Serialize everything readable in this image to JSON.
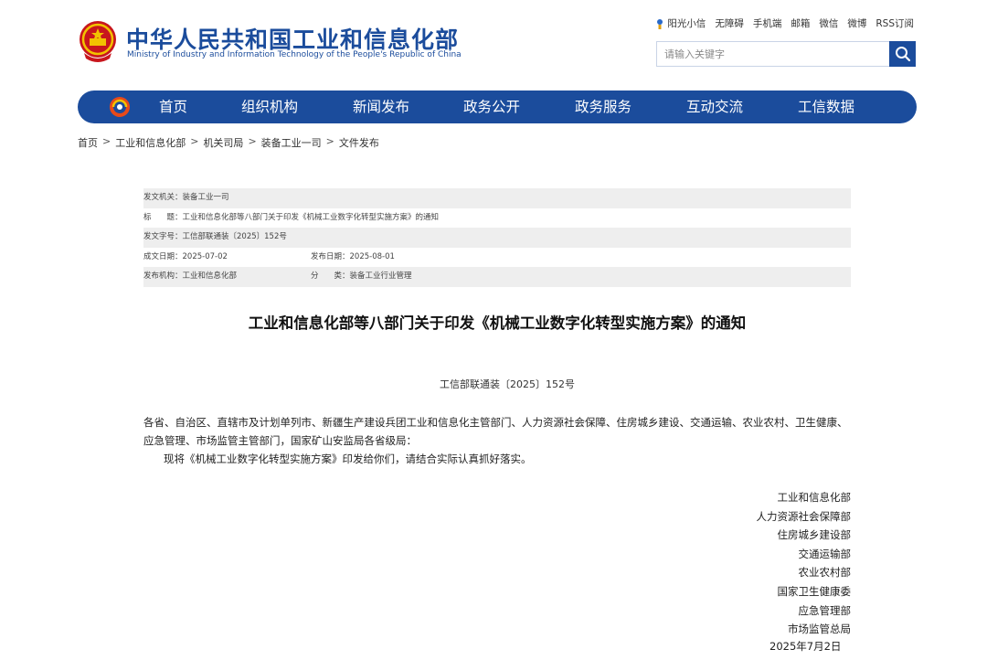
{
  "header": {
    "title_cn": "中华人民共和国工业和信息化部",
    "title_en": "Ministry of Industry and Information Technology of the People's Republic of China",
    "top_links": [
      "阳光小信",
      "无障碍",
      "手机端",
      "邮箱",
      "微信",
      "微博",
      "RSS订阅"
    ],
    "search_placeholder": "请输入关键字",
    "brand_color": "#1b4c9c"
  },
  "nav": {
    "items": [
      "首页",
      "组织机构",
      "新闻发布",
      "政务公开",
      "政务服务",
      "互动交流",
      "工信数据"
    ]
  },
  "breadcrumb": [
    "首页",
    "工业和信息化部",
    "机关司局",
    "装备工业一司",
    "文件发布"
  ],
  "meta": {
    "issuer": "发文机关：装备工业一司",
    "title": "标　　题：工业和信息化部等八部门关于印发《机械工业数字化转型实施方案》的通知",
    "doc_no": "发文字号：工信部联通装〔2025〕152号",
    "created": "成文日期：2025-07-02",
    "published": "发布日期：2025-08-01",
    "publisher": "发布机构：工业和信息化部",
    "category": "分　　类：装备工业行业管理"
  },
  "article": {
    "title": "工业和信息化部等八部门关于印发《机械工业数字化转型实施方案》的通知",
    "doc_number": "工信部联通装〔2025〕152号",
    "addressees": "各省、自治区、直辖市及计划单列市、新疆生产建设兵团工业和信息化主管部门、人力资源社会保障、住房城乡建设、交通运输、农业农村、卫生健康、应急管理、市场监管主管部门，国家矿山安监局各省级局：",
    "body": "现将《机械工业数字化转型实施方案》印发给你们，请结合实际认真抓好落实。",
    "signers": [
      "工业和信息化部",
      "人力资源社会保障部",
      "住房城乡建设部",
      "交通运输部",
      "农业农村部",
      "国家卫生健康委",
      "应急管理部",
      "市场监管总局"
    ],
    "date": "2025年7月2日"
  }
}
